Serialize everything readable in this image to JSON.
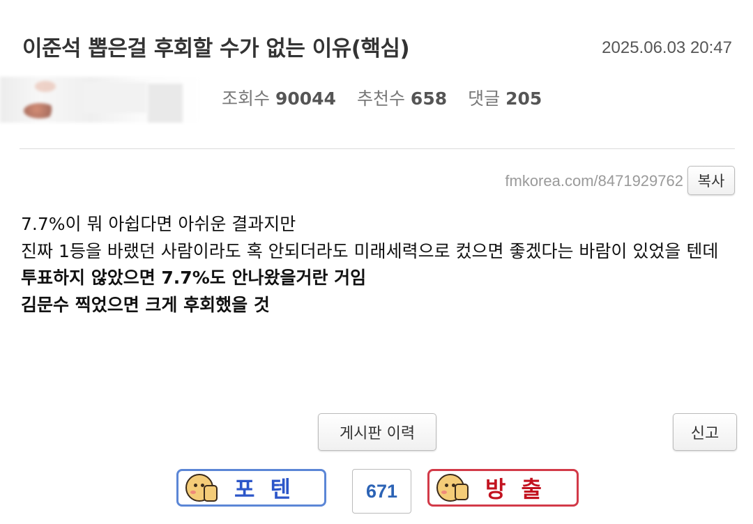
{
  "post": {
    "title": "이준석 뽑은걸 후회할 수가 없는 이유(핵심)",
    "date": "2025.06.03 20:47"
  },
  "stats": {
    "views_label": "조회수",
    "views_value": "90044",
    "recommend_label": "추천수",
    "recommend_value": "658",
    "comments_label": "댓글",
    "comments_value": "205"
  },
  "url": {
    "text": "fmkorea.com/8471929762",
    "copy_label": "복사"
  },
  "content": {
    "lines": [
      "7.7%이 뭐 아쉽다면 아쉬운 결과지만",
      "진짜 1등을 바랬던 사람이라도 혹 안되더라도 미래세력으로 컸으면 좋겠다는 바람이 있었을 텐데",
      "투표하지 않았으면 7.7%도 안나왔을거란 거임",
      "김문수 찍었으면 크게 후회했을 것"
    ]
  },
  "actions": {
    "history_label": "게시판 이력",
    "report_label": "신고"
  },
  "vote": {
    "up_label": "포텐",
    "count": "671",
    "down_label": "방출"
  },
  "colors": {
    "up_border": "#5b86d6",
    "up_text": "#2c56c9",
    "down_border": "#d23a48",
    "down_text": "#c2121f",
    "count_text": "#2c63b5"
  }
}
